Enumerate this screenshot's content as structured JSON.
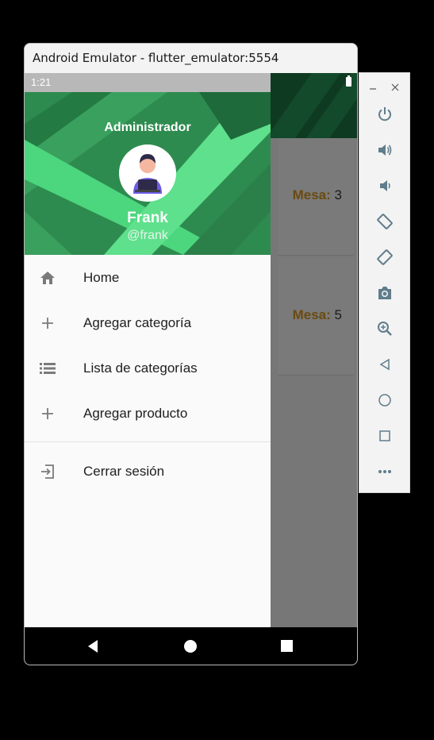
{
  "window": {
    "title": "Android Emulator - flutter_emulator:5554"
  },
  "status_bar": {
    "time": "1:21"
  },
  "drawer": {
    "header": {
      "role": "Administrador",
      "name": "Frank",
      "username": "@frank"
    },
    "items": [
      {
        "label": "Home",
        "icon": "home-icon"
      },
      {
        "label": "Agregar categoría",
        "icon": "plus-icon"
      },
      {
        "label": "Lista de categorías",
        "icon": "list-icon"
      },
      {
        "label": "Agregar producto",
        "icon": "plus-icon"
      }
    ],
    "logout": {
      "label": "Cerrar sesión",
      "icon": "logout-icon"
    }
  },
  "background_app": {
    "cards": [
      {
        "label": "Mesa:",
        "value": "3"
      },
      {
        "label": "Mesa:",
        "value": "5"
      }
    ]
  },
  "colors": {
    "header_green": "#2d8a4e",
    "mesa_label": "#6b4a10",
    "appbar": "#0f3a22"
  },
  "side_toolbar": {
    "buttons": [
      "power-icon",
      "volume-up-icon",
      "volume-down-icon",
      "rotate-left-icon",
      "rotate-right-icon",
      "camera-icon",
      "zoom-icon",
      "back-icon",
      "home-circle-icon",
      "overview-icon",
      "more-icon"
    ]
  }
}
